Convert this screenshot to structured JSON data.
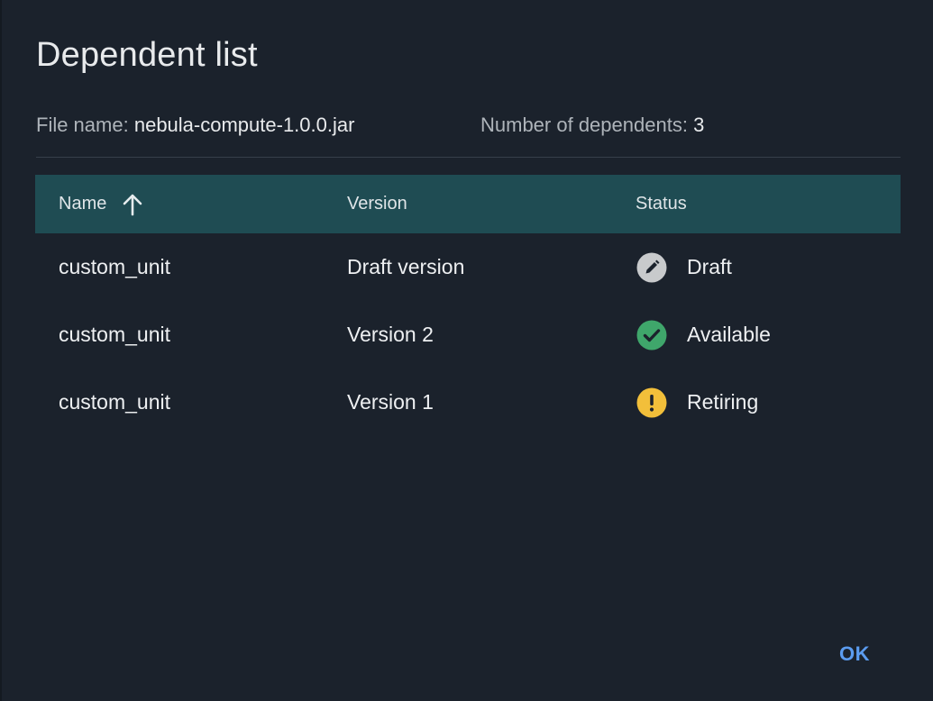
{
  "dialog": {
    "title": "Dependent list",
    "file_name_label": "File name:",
    "file_name_value": "nebula-compute-1.0.0.jar",
    "dependents_label": "Number of dependents:",
    "dependents_value": "3",
    "ok_label": "OK"
  },
  "table": {
    "headers": {
      "name": "Name",
      "version": "Version",
      "status": "Status"
    },
    "sort": {
      "column": "Name",
      "direction": "ascending",
      "icon": "arrow-up-icon"
    },
    "rows": [
      {
        "name": "custom_unit",
        "version": "Draft version",
        "status": "Draft",
        "status_icon": "pencil-icon",
        "status_color": "#c8cacc"
      },
      {
        "name": "custom_unit",
        "version": "Version 2",
        "status": "Available",
        "status_icon": "check-circle-icon",
        "status_color": "#3fa66b"
      },
      {
        "name": "custom_unit",
        "version": "Version 1",
        "status": "Retiring",
        "status_icon": "warning-icon",
        "status_color": "#f2bf3a"
      }
    ]
  },
  "colors": {
    "background": "#1b222c",
    "header_background": "#1f4c53",
    "accent": "#5b9cf0"
  }
}
